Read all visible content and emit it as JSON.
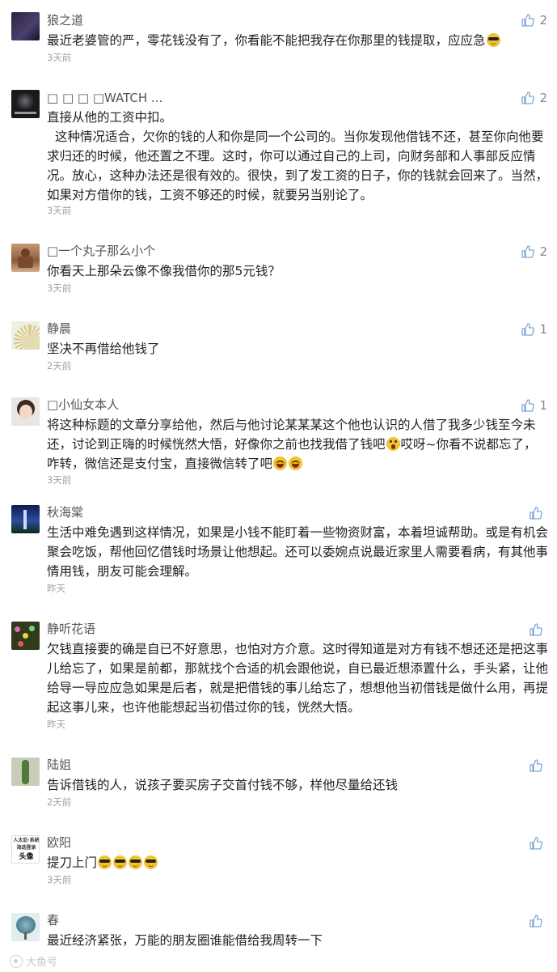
{
  "comments": [
    {
      "name": "狼之道",
      "text": "最近老婆管的严，零花钱没有了，你看能不能把我存在你那里的钱提取，应应急",
      "emoji": [
        "cool"
      ],
      "time": "3天前",
      "likes": "2",
      "avatar": "dark-purple"
    },
    {
      "name": "□ □ □ □WATCH ...",
      "text1": "直接从他的工资中扣。",
      "text2": "这种情况适合，欠你的钱的人和你是同一个公司的。当你发现他借钱不还，甚至你向他要求归还的时候，他还置之不理。这时，你可以通过自己的上司，向财务部和人事部反应情况。放心，这种办法还是很有效的。很快，到了发工资的日子，你的钱就会回来了。当然，如果对方借你的钱，工资不够还的时候，就要另当别论了。",
      "time": "3天前",
      "likes": "2",
      "avatar": "watch"
    },
    {
      "name": "□一个丸子那么小个",
      "text": "你看天上那朵云像不像我借你的那5元钱？",
      "time": "3天前",
      "likes": "2",
      "avatar": "brown"
    },
    {
      "name": "静晨",
      "text": "坚决不再借给他钱了",
      "time": "2天前",
      "likes": "1",
      "avatar": "fan"
    },
    {
      "name": "□小仙女本人",
      "text_a": "将这种标题的文章分享给他，然后与他讨论某某某这个他也认识的人借了我多少钱至今未还，讨论到正嗨的时候恍然大悟，好像你之前也找我借了钱吧",
      "text_b": "哎呀~你看不说都忘了，咋转，微信还是支付宝，直接微信转了吧",
      "time": "3天前",
      "likes": "1",
      "avatar": "girl"
    },
    {
      "name": "秋海棠",
      "text": "生活中难免遇到这样情况，如果是小钱不能盯着一些物资财富，本着坦诚帮助。或是有机会聚会吃饭，帮他回忆借钱时场景让他想起。还可以委婉点说最近家里人需要看病，有其他事情用钱，朋友可能会理解。",
      "time": "昨天",
      "likes": "",
      "avatar": "night"
    },
    {
      "name": "静听花语",
      "text": "欠钱直接要的确是自已不好意思，也怕对方介意。这时得知道是对方有钱不想还还是把这事儿给忘了，如果是前都，那就找个合适的机会跟他说，自已最近想添置什么，手头紧，让他给导一导应应急如果是后者，就是把借钱的事儿给忘了，想想他当初借钱是做什么用，再提起这事儿来，也许他能想起当初借过你的钱，恍然大悟。",
      "time": "昨天",
      "likes": "",
      "avatar": "flowers"
    },
    {
      "name": "陆姐",
      "text": "告诉借钱的人，说孩子要买房子交首付钱不够，样他尽量给还钱",
      "time": "2天前",
      "likes": "",
      "avatar": "cactus"
    },
    {
      "name": "欧阳",
      "text": "提刀上门",
      "emoji_count": 4,
      "time": "3天前",
      "likes": "",
      "avatar": "text",
      "avatar_lines": [
        "人太忍·系统",
        "海选登录",
        "头像"
      ]
    },
    {
      "name": "春",
      "text": "最近经济紧张，万能的朋友圈谁能借给我周转一下",
      "time": "",
      "likes": "",
      "avatar": "tree"
    }
  ],
  "watermark": "大鱼号",
  "colors": {
    "name": "#555555",
    "text": "#222222",
    "time": "#a0a0a0",
    "like": "#888888"
  }
}
